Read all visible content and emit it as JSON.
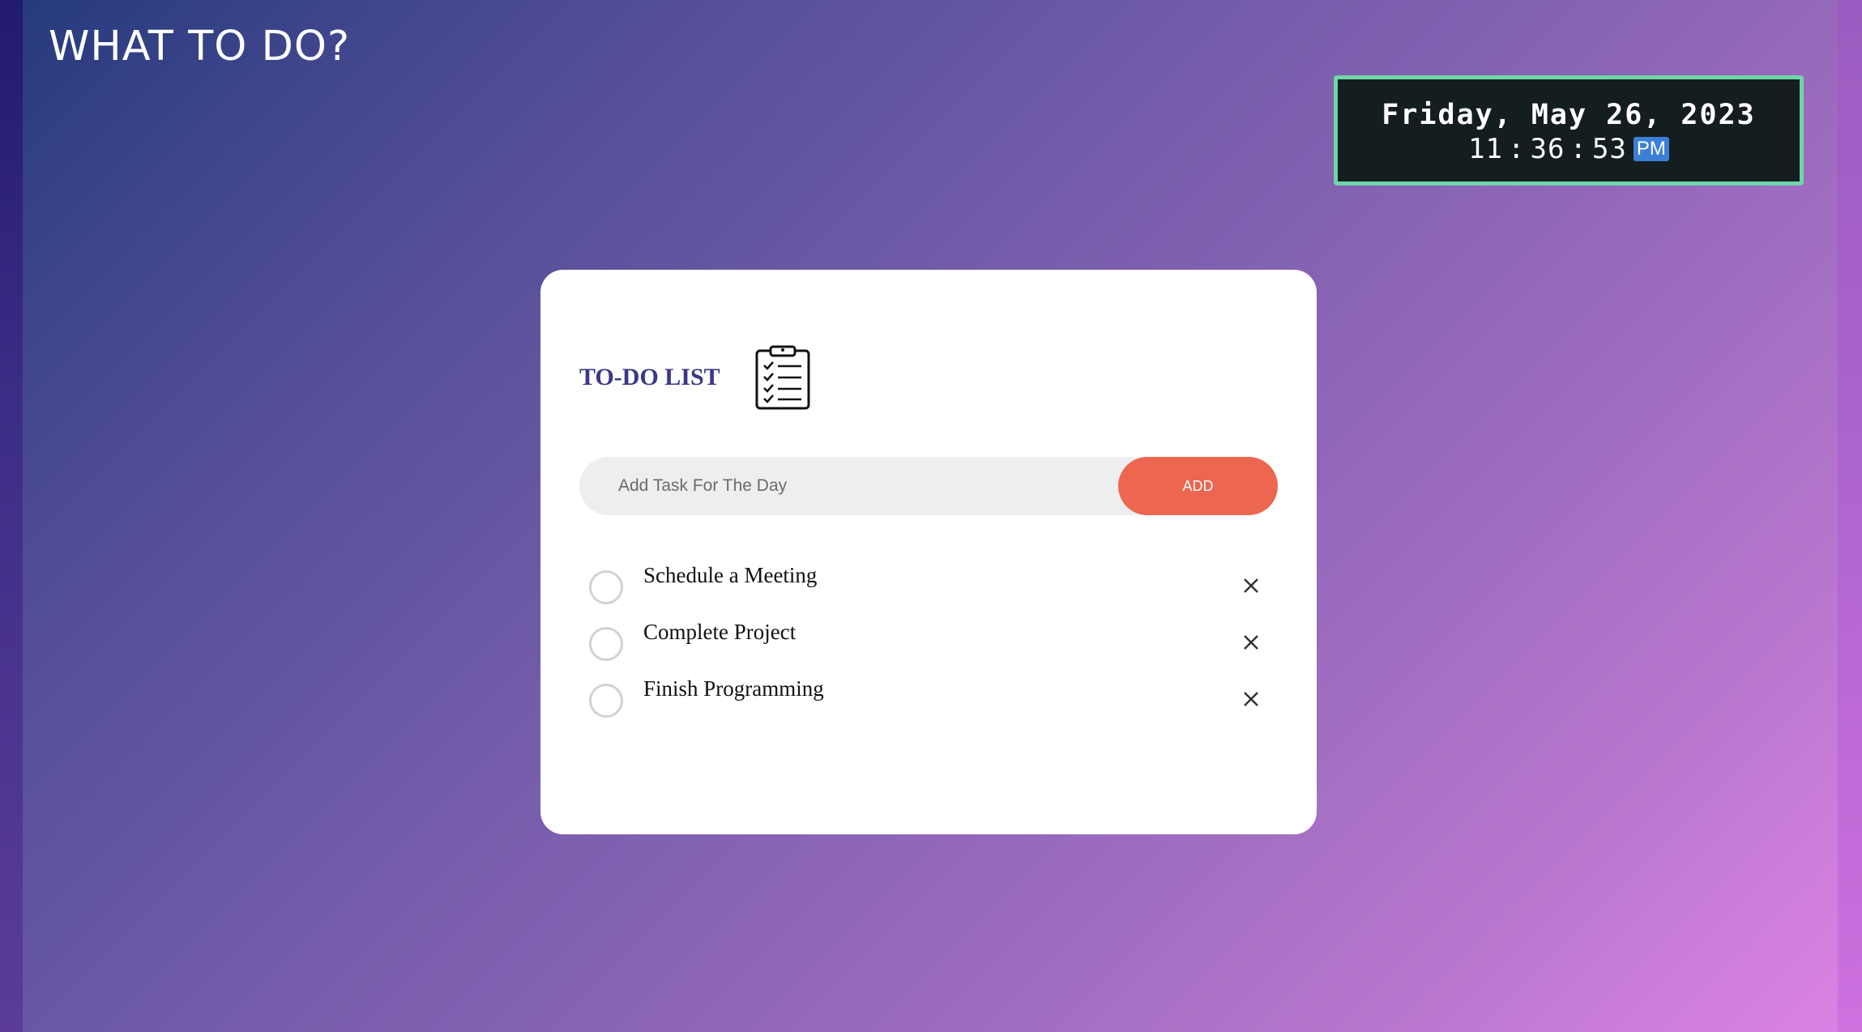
{
  "header": {
    "title": "WHAT TO DO?"
  },
  "clock": {
    "date": "Friday, May 26, 2023",
    "hours": "11",
    "minutes": "36",
    "seconds": "53",
    "separator": ":",
    "ampm": "PM"
  },
  "todo": {
    "title": "TO-DO LIST",
    "icon": "clipboard-checklist-icon",
    "input": {
      "placeholder": "Add Task For The Day",
      "value": ""
    },
    "add_label": "ADD",
    "tasks": [
      {
        "label": "Schedule a Meeting",
        "completed": false
      },
      {
        "label": "Complete Project",
        "completed": false
      },
      {
        "label": "Finish Programming",
        "completed": false
      }
    ]
  },
  "colors": {
    "accent_add": "#ec6650",
    "title_text": "#3b3688",
    "clock_bg": "#141d1f",
    "clock_border": "#6fd5a8",
    "ampm_badge": "#3b7fd6"
  }
}
